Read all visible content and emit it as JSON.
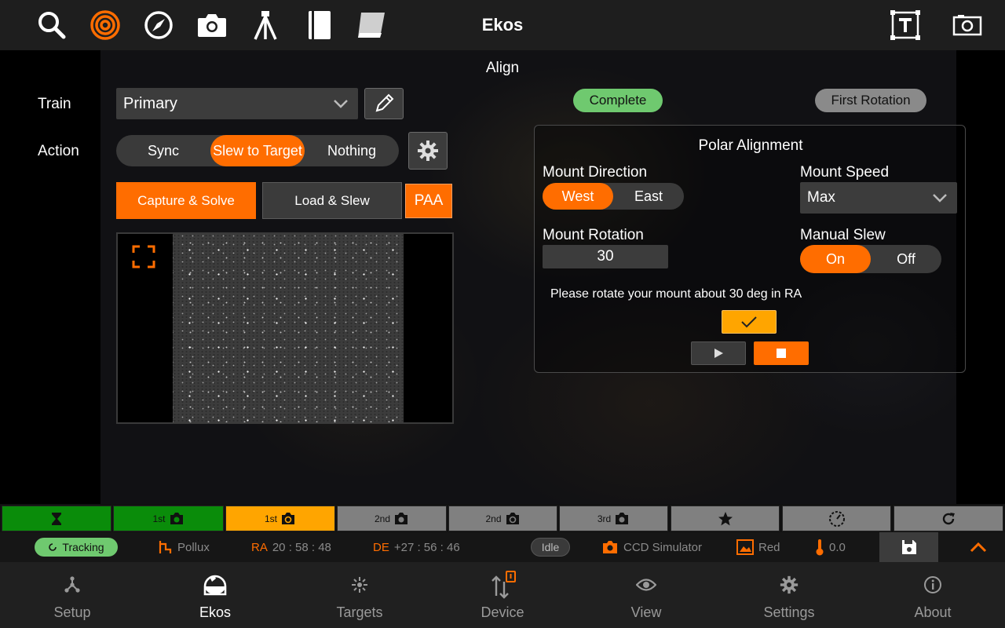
{
  "app": {
    "title": "Ekos"
  },
  "toolbar": {
    "icons": [
      "search-icon",
      "target-icon",
      "compass-icon",
      "camera-icon",
      "tripod-icon",
      "notebook-icon",
      "flat-panel-icon"
    ],
    "right_icons": [
      "text-frame-icon",
      "screenshot-icon"
    ]
  },
  "align": {
    "section_title": "Align",
    "train_label": "Train",
    "train_value": "Primary",
    "action_label": "Action",
    "actions": [
      "Sync",
      "Slew to Target",
      "Nothing"
    ],
    "active_action": "Slew to Target",
    "capture_solve": "Capture & Solve",
    "load_slew": "Load & Slew",
    "paa": "PAA",
    "status_complete": "Complete",
    "stage_label": "First Rotation"
  },
  "polar": {
    "title": "Polar Alignment",
    "mount_direction_label": "Mount Direction",
    "directions": [
      "West",
      "East"
    ],
    "direction_active": "West",
    "mount_speed_label": "Mount Speed",
    "mount_speed_value": "Max",
    "mount_rotation_label": "Mount Rotation",
    "mount_rotation_value": "30",
    "manual_slew_label": "Manual Slew",
    "manual_slew_options": [
      "On",
      "Off"
    ],
    "manual_slew_active": "On",
    "message": "Please rotate your mount about 30 deg in RA"
  },
  "progress": {
    "stages": [
      {
        "label": "",
        "icon": "hourglass-icon",
        "state": "done"
      },
      {
        "label": "1st",
        "icon": "camera-icon",
        "state": "done"
      },
      {
        "label": "1st",
        "icon": "camera-rotate-icon",
        "state": "active"
      },
      {
        "label": "2nd",
        "icon": "camera-icon",
        "state": "pending"
      },
      {
        "label": "2nd",
        "icon": "camera-rotate-icon",
        "state": "pending"
      },
      {
        "label": "3rd",
        "icon": "camera-icon",
        "state": "pending"
      },
      {
        "label": "",
        "icon": "star-icon",
        "state": "pending"
      },
      {
        "label": "",
        "icon": "dial-icon",
        "state": "pending"
      },
      {
        "label": "",
        "icon": "refresh-icon",
        "state": "pending"
      }
    ]
  },
  "status": {
    "tracking": "Tracking",
    "target": "Pollux",
    "ra_label": "RA",
    "ra_value": "20 : 58 : 48",
    "de_label": "DE",
    "de_value": "+27 : 56 : 46",
    "idle": "Idle",
    "camera": "CCD Simulator",
    "filter": "Red",
    "temperature": "0.0"
  },
  "nav": {
    "items": [
      {
        "label": "Setup",
        "icon": "setup-icon"
      },
      {
        "label": "Ekos",
        "icon": "dome-icon"
      },
      {
        "label": "Targets",
        "icon": "targets-icon"
      },
      {
        "label": "Device",
        "icon": "device-icon"
      },
      {
        "label": "View",
        "icon": "eye-icon"
      },
      {
        "label": "Settings",
        "icon": "gear-icon"
      },
      {
        "label": "About",
        "icon": "info-icon"
      }
    ],
    "active": "Ekos"
  },
  "colors": {
    "accent": "#ff6d00",
    "complete": "#6fc96f",
    "done": "#0a8c0a",
    "active_stage": "#ffa500",
    "pending": "#808080"
  }
}
